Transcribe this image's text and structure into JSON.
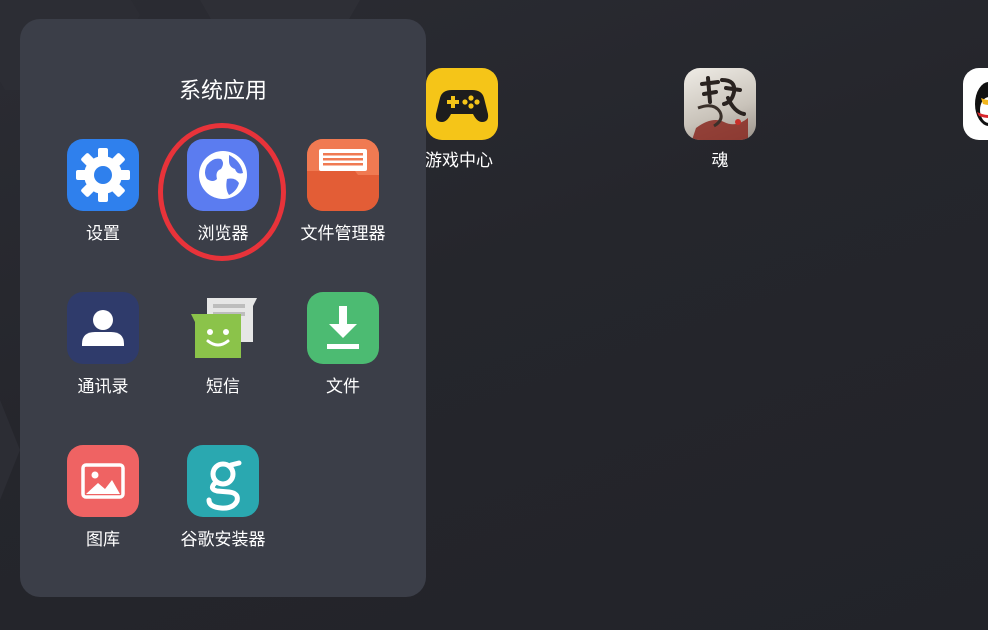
{
  "folder": {
    "title": "系统应用",
    "apps": [
      {
        "label": "设置",
        "icon": "settings-gear-icon",
        "color": "#2f80ed"
      },
      {
        "label": "浏览器",
        "icon": "globe-icon",
        "color": "#5b7cf0"
      },
      {
        "label": "文件管理器",
        "icon": "file-manager-folder-icon",
        "color": "#e35d36"
      },
      {
        "label": "通讯录",
        "icon": "contacts-person-icon",
        "color": "#2f3b6b"
      },
      {
        "label": "短信",
        "icon": "sms-smiley-bubble-icon",
        "color": "#8bc34a"
      },
      {
        "label": "文件",
        "icon": "download-arrow-icon",
        "color": "#4cbb72"
      },
      {
        "label": "图库",
        "icon": "gallery-image-icon",
        "color": "#ef6363"
      },
      {
        "label": "谷歌安装器",
        "icon": "google-installer-g-icon",
        "color": "#2aa8b0"
      }
    ]
  },
  "desktop": {
    "apps": [
      {
        "label": "游戏中心",
        "icon": "gamepad-icon",
        "color": "#f5c518"
      },
      {
        "label": "魂",
        "icon": "hun-game-art-icon",
        "color": "#d9d5cf"
      },
      {
        "label": "",
        "icon": "qq-penguin-icon",
        "color": "#ffffff"
      }
    ]
  },
  "highlight": {
    "color": "#e8333a",
    "target": "浏览器"
  }
}
